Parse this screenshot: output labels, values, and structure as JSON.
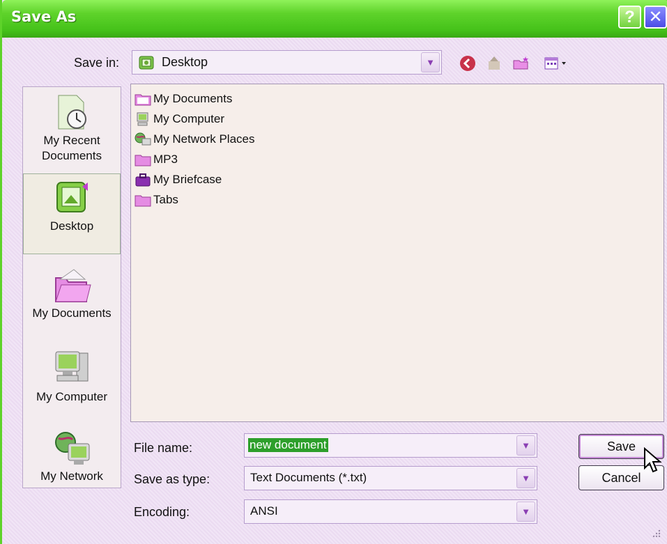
{
  "window": {
    "title": "Save As",
    "help_symbol": "?",
    "close_symbol": "✕"
  },
  "save_in": {
    "label": "Save in:",
    "value": "Desktop",
    "icon": "desktop-icon"
  },
  "toolbar": {
    "buttons": [
      "back-icon",
      "up-folder-icon",
      "new-folder-icon",
      "views-menu-icon"
    ]
  },
  "places_bar": {
    "items": [
      {
        "label1": "My Recent",
        "label2": "Documents",
        "icon": "recent-documents-icon"
      },
      {
        "label1": "Desktop",
        "label2": "",
        "icon": "desktop-icon",
        "selected": true
      },
      {
        "label1": "My Documents",
        "label2": "",
        "icon": "my-documents-icon"
      },
      {
        "label1": "My Computer",
        "label2": "",
        "icon": "my-computer-icon"
      },
      {
        "label1": "My Network",
        "label2": "",
        "icon": "my-network-icon"
      }
    ]
  },
  "file_list": {
    "items": [
      {
        "name": "My Documents",
        "icon": "my-documents-folder-icon"
      },
      {
        "name": "My Computer",
        "icon": "my-computer-icon"
      },
      {
        "name": "My Network Places",
        "icon": "network-places-icon"
      },
      {
        "name": "MP3",
        "icon": "folder-icon"
      },
      {
        "name": "My Briefcase",
        "icon": "briefcase-icon"
      },
      {
        "name": "Tabs",
        "icon": "folder-icon"
      }
    ]
  },
  "form": {
    "file_name_label": "File name:",
    "file_name_value": "new document",
    "save_as_type_label": "Save as type:",
    "save_as_type_value": "Text Documents (*.txt)",
    "encoding_label": "Encoding:",
    "encoding_value": "ANSI"
  },
  "buttons": {
    "save": "Save",
    "cancel": "Cancel"
  },
  "colors": {
    "titlebar": "#5fd32b",
    "dialog_bg": "#efe2f4",
    "selection": "#2d9f2b",
    "close_button": "#4b4de6"
  }
}
